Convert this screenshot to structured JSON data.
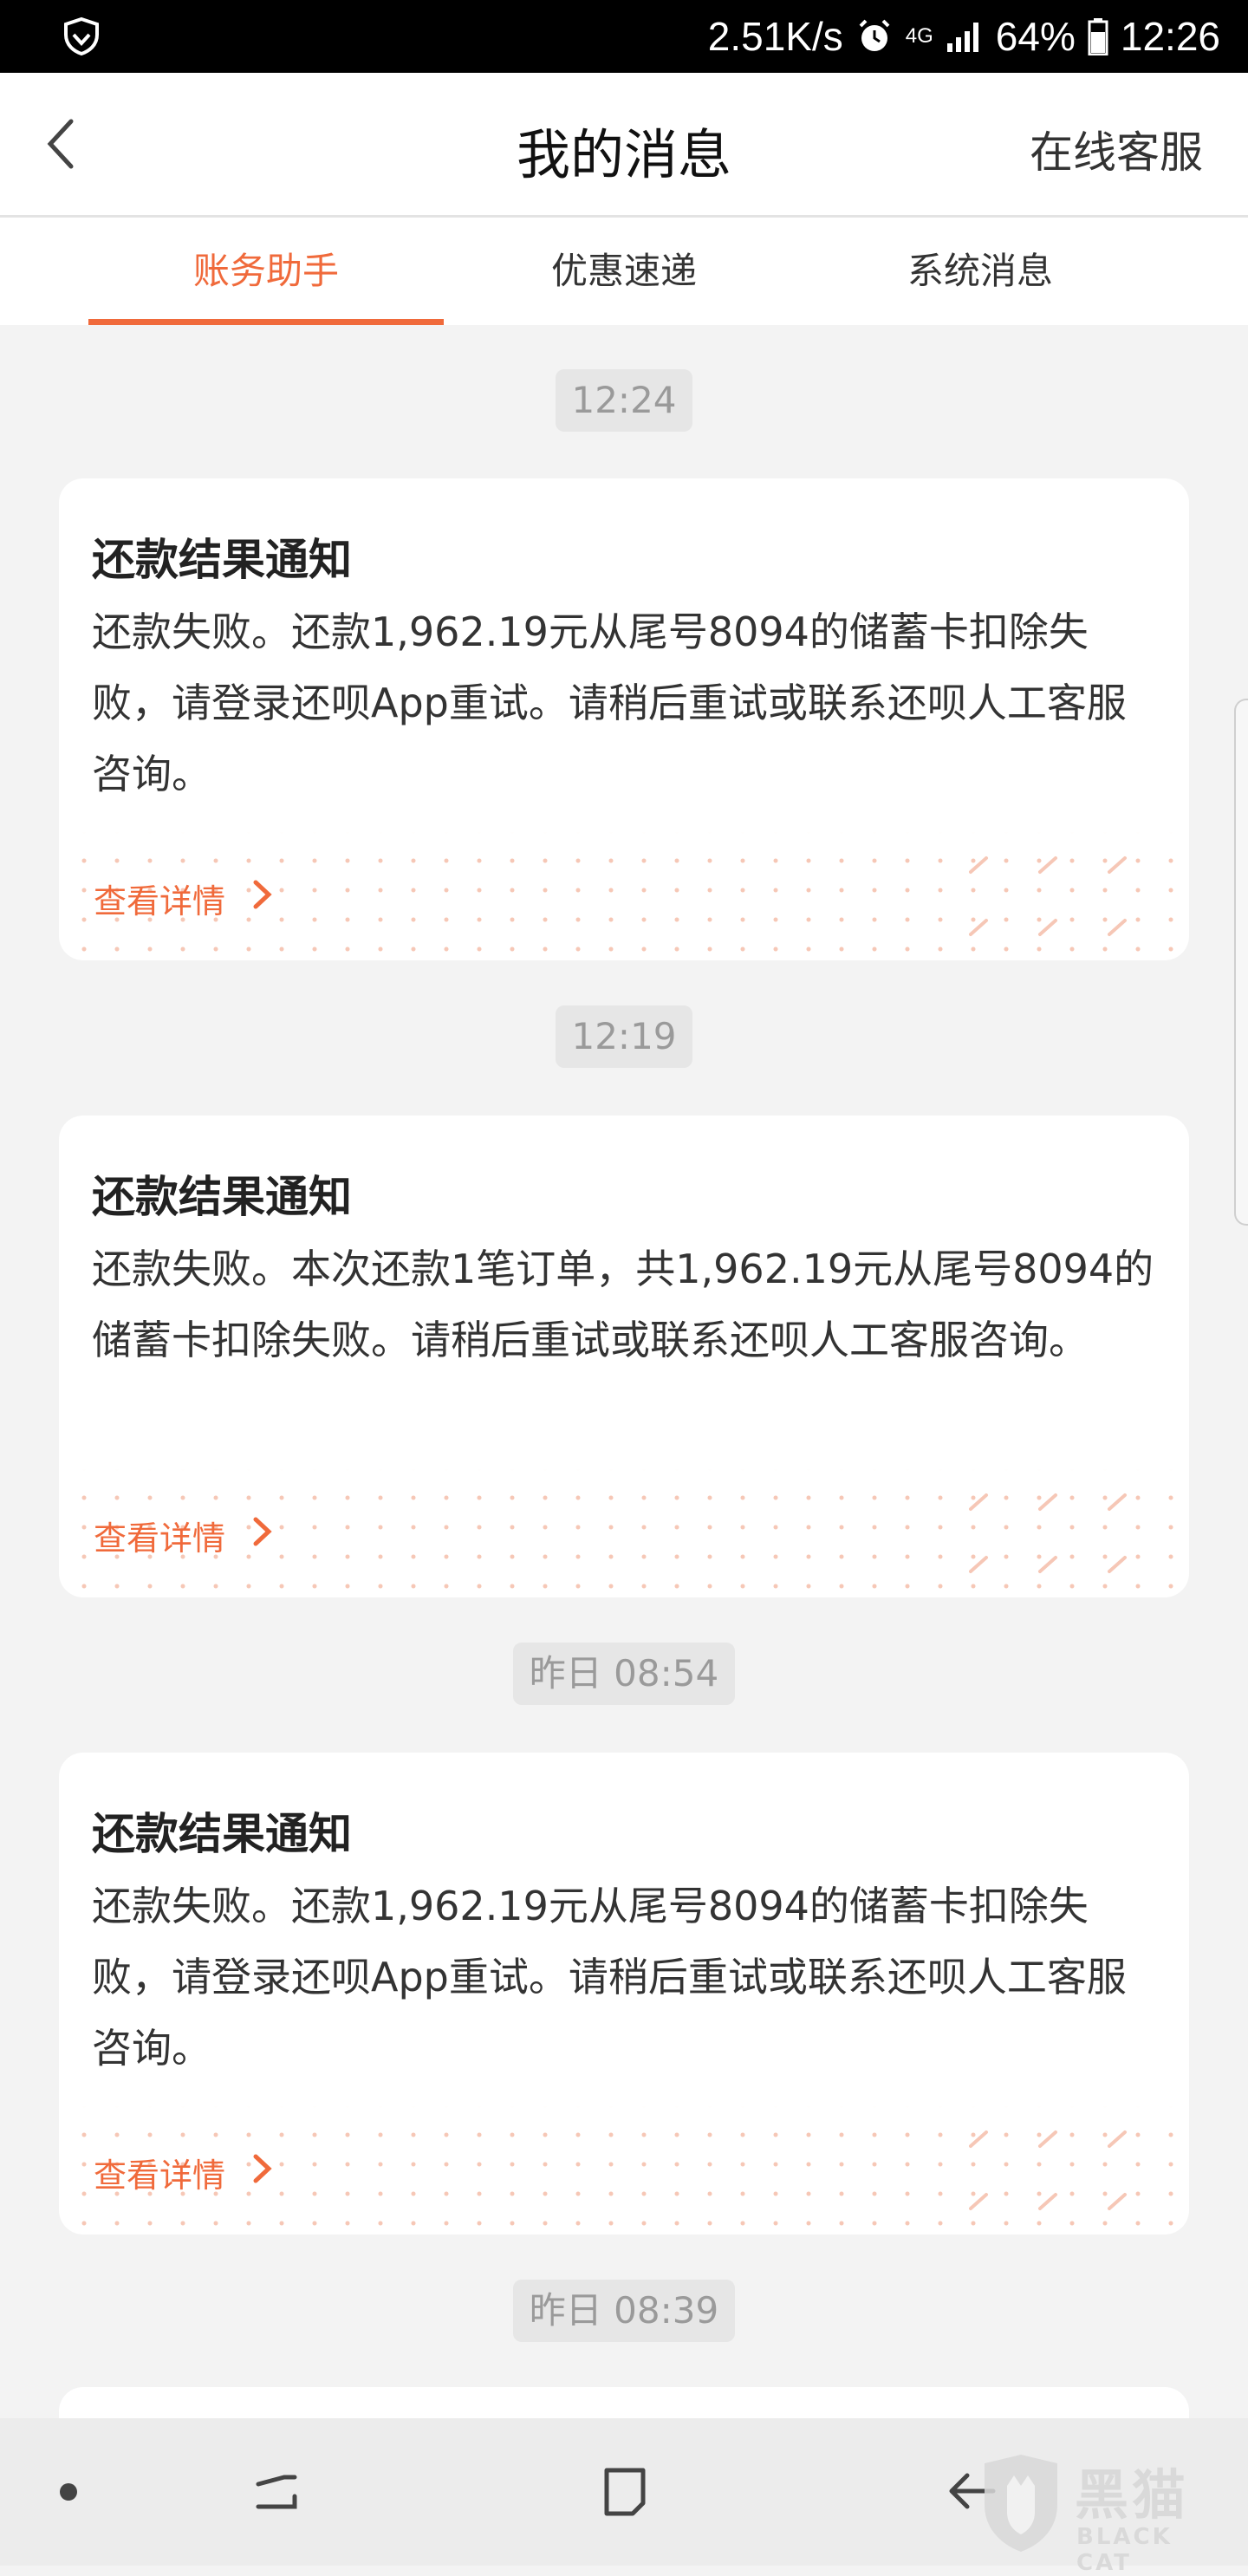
{
  "status_bar": {
    "shield_icon": "shield-icon",
    "net_speed": "2.51K/s",
    "alarm_icon": "alarm-icon",
    "network_type": "4G",
    "signal_icon": "signal-icon",
    "battery_percent": "64%",
    "battery_icon": "battery-icon",
    "time": "12:26"
  },
  "header": {
    "back_icon": "chevron-left-icon",
    "title": "我的消息",
    "right_link": "在线客服"
  },
  "tabs": [
    {
      "label": "账务助手",
      "active": true
    },
    {
      "label": "优惠速递",
      "active": false
    },
    {
      "label": "系统消息",
      "active": false
    }
  ],
  "messages": [
    {
      "time": "12:24",
      "title": "还款结果通知",
      "body": "还款失败。还款1,962.19元从尾号8094的储蓄卡扣除失败，请登录还呗App重试。请稍后重试或联系还呗人工客服咨询。",
      "link": "查看详情"
    },
    {
      "time": "12:19",
      "title": "还款结果通知",
      "body": "还款失败。本次还款1笔订单，共1,962.19元从尾号8094的储蓄卡扣除失败。请稍后重试或联系还呗人工客服咨询。",
      "link": "查看详情"
    },
    {
      "time": "昨日 08:54",
      "title": "还款结果通知",
      "body": "还款失败。还款1,962.19元从尾号8094的储蓄卡扣除失败，请登录还呗App重试。请稍后重试或联系还呗人工客服咨询。",
      "link": "查看详情"
    },
    {
      "time": "昨日 08:39"
    }
  ],
  "nav_bar": {
    "items": [
      "dot-icon",
      "recents-icon",
      "home-icon",
      "back-icon"
    ]
  },
  "watermark": {
    "text_cn": "黑猫",
    "text_en": "BLACK CAT"
  },
  "colors": {
    "accent": "#f06a3b",
    "background": "#f3f3f3"
  }
}
